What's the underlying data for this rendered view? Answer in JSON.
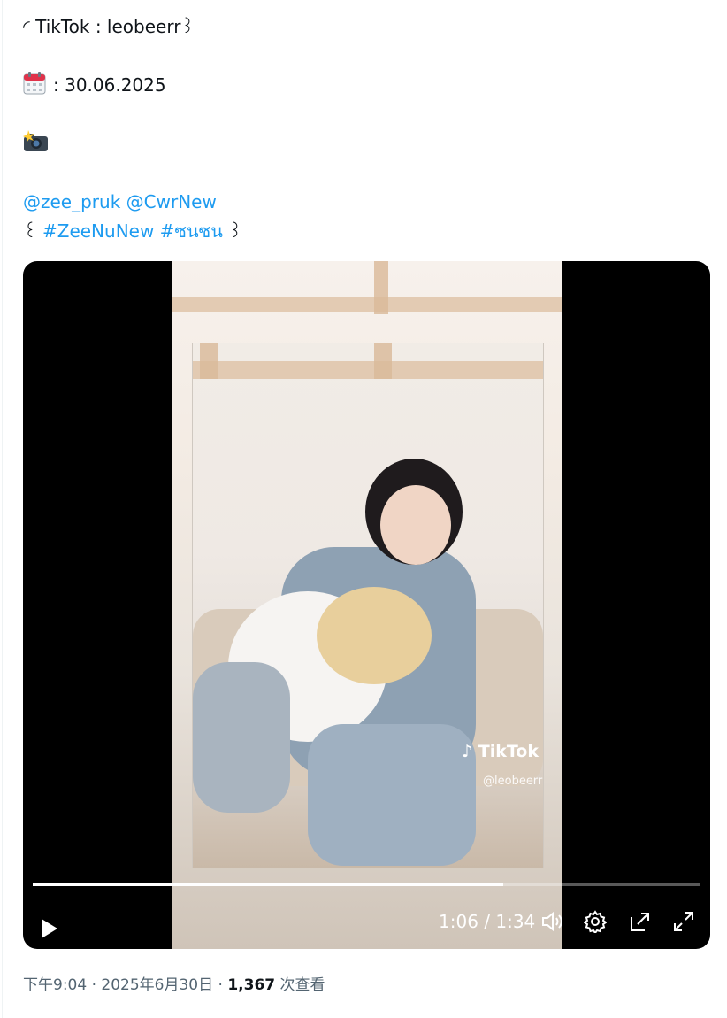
{
  "tweet": {
    "line1": "◜ TikTok : leobeerr꒱",
    "date_text": ": 30.06.2025",
    "mention_1": "@zee_pruk",
    "mention_2": "@CwrNew",
    "bracket_open": "꒰",
    "hashtag_1": "#ZeeNuNew",
    "hashtag_2": "#ซนซน",
    "bracket_close": "꒱"
  },
  "video": {
    "current_time": "1:06",
    "duration": "1:34",
    "time_display": "1:06 / 1:34",
    "progress": 0.705,
    "watermark_brand": "TikTok",
    "watermark_handle": "@leobeerr"
  },
  "meta": {
    "time": "下午9:04",
    "date": "2025年6月30日",
    "views_count": "1,367",
    "views_label": "次查看"
  },
  "icons": {
    "calendar": "calendar-icon",
    "camera": "camera-flash-icon",
    "play": "play-icon",
    "volume": "volume-icon",
    "settings": "settings-icon",
    "popout": "popout-icon",
    "fullscreen": "fullscreen-icon"
  },
  "colors": {
    "link": "#1d9bf0",
    "text": "#0f1419",
    "muted": "#536471"
  }
}
